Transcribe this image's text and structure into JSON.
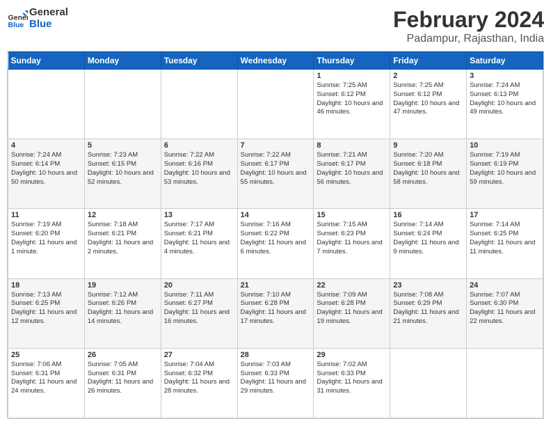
{
  "header": {
    "logo_line1": "General",
    "logo_line2": "Blue",
    "month": "February 2024",
    "location": "Padampur, Rajasthan, India"
  },
  "weekdays": [
    "Sunday",
    "Monday",
    "Tuesday",
    "Wednesday",
    "Thursday",
    "Friday",
    "Saturday"
  ],
  "weeks": [
    [
      {
        "day": "",
        "sunrise": "",
        "sunset": "",
        "daylight": ""
      },
      {
        "day": "",
        "sunrise": "",
        "sunset": "",
        "daylight": ""
      },
      {
        "day": "",
        "sunrise": "",
        "sunset": "",
        "daylight": ""
      },
      {
        "day": "",
        "sunrise": "",
        "sunset": "",
        "daylight": ""
      },
      {
        "day": "1",
        "sunrise": "7:25 AM",
        "sunset": "6:12 PM",
        "daylight": "10 hours and 46 minutes."
      },
      {
        "day": "2",
        "sunrise": "7:25 AM",
        "sunset": "6:12 PM",
        "daylight": "10 hours and 47 minutes."
      },
      {
        "day": "3",
        "sunrise": "7:24 AM",
        "sunset": "6:13 PM",
        "daylight": "10 hours and 49 minutes."
      }
    ],
    [
      {
        "day": "4",
        "sunrise": "7:24 AM",
        "sunset": "6:14 PM",
        "daylight": "10 hours and 50 minutes."
      },
      {
        "day": "5",
        "sunrise": "7:23 AM",
        "sunset": "6:15 PM",
        "daylight": "10 hours and 52 minutes."
      },
      {
        "day": "6",
        "sunrise": "7:22 AM",
        "sunset": "6:16 PM",
        "daylight": "10 hours and 53 minutes."
      },
      {
        "day": "7",
        "sunrise": "7:22 AM",
        "sunset": "6:17 PM",
        "daylight": "10 hours and 55 minutes."
      },
      {
        "day": "8",
        "sunrise": "7:21 AM",
        "sunset": "6:17 PM",
        "daylight": "10 hours and 56 minutes."
      },
      {
        "day": "9",
        "sunrise": "7:20 AM",
        "sunset": "6:18 PM",
        "daylight": "10 hours and 58 minutes."
      },
      {
        "day": "10",
        "sunrise": "7:19 AM",
        "sunset": "6:19 PM",
        "daylight": "10 hours and 59 minutes."
      }
    ],
    [
      {
        "day": "11",
        "sunrise": "7:19 AM",
        "sunset": "6:20 PM",
        "daylight": "11 hours and 1 minute."
      },
      {
        "day": "12",
        "sunrise": "7:18 AM",
        "sunset": "6:21 PM",
        "daylight": "11 hours and 2 minutes."
      },
      {
        "day": "13",
        "sunrise": "7:17 AM",
        "sunset": "6:21 PM",
        "daylight": "11 hours and 4 minutes."
      },
      {
        "day": "14",
        "sunrise": "7:16 AM",
        "sunset": "6:22 PM",
        "daylight": "11 hours and 6 minutes."
      },
      {
        "day": "15",
        "sunrise": "7:15 AM",
        "sunset": "6:23 PM",
        "daylight": "11 hours and 7 minutes."
      },
      {
        "day": "16",
        "sunrise": "7:14 AM",
        "sunset": "6:24 PM",
        "daylight": "11 hours and 9 minutes."
      },
      {
        "day": "17",
        "sunrise": "7:14 AM",
        "sunset": "6:25 PM",
        "daylight": "11 hours and 11 minutes."
      }
    ],
    [
      {
        "day": "18",
        "sunrise": "7:13 AM",
        "sunset": "6:25 PM",
        "daylight": "11 hours and 12 minutes."
      },
      {
        "day": "19",
        "sunrise": "7:12 AM",
        "sunset": "6:26 PM",
        "daylight": "11 hours and 14 minutes."
      },
      {
        "day": "20",
        "sunrise": "7:11 AM",
        "sunset": "6:27 PM",
        "daylight": "11 hours and 16 minutes."
      },
      {
        "day": "21",
        "sunrise": "7:10 AM",
        "sunset": "6:28 PM",
        "daylight": "11 hours and 17 minutes."
      },
      {
        "day": "22",
        "sunrise": "7:09 AM",
        "sunset": "6:28 PM",
        "daylight": "11 hours and 19 minutes."
      },
      {
        "day": "23",
        "sunrise": "7:08 AM",
        "sunset": "6:29 PM",
        "daylight": "11 hours and 21 minutes."
      },
      {
        "day": "24",
        "sunrise": "7:07 AM",
        "sunset": "6:30 PM",
        "daylight": "11 hours and 22 minutes."
      }
    ],
    [
      {
        "day": "25",
        "sunrise": "7:06 AM",
        "sunset": "6:31 PM",
        "daylight": "11 hours and 24 minutes."
      },
      {
        "day": "26",
        "sunrise": "7:05 AM",
        "sunset": "6:31 PM",
        "daylight": "11 hours and 26 minutes."
      },
      {
        "day": "27",
        "sunrise": "7:04 AM",
        "sunset": "6:32 PM",
        "daylight": "11 hours and 28 minutes."
      },
      {
        "day": "28",
        "sunrise": "7:03 AM",
        "sunset": "6:33 PM",
        "daylight": "11 hours and 29 minutes."
      },
      {
        "day": "29",
        "sunrise": "7:02 AM",
        "sunset": "6:33 PM",
        "daylight": "11 hours and 31 minutes."
      },
      {
        "day": "",
        "sunrise": "",
        "sunset": "",
        "daylight": ""
      },
      {
        "day": "",
        "sunrise": "",
        "sunset": "",
        "daylight": ""
      }
    ]
  ]
}
